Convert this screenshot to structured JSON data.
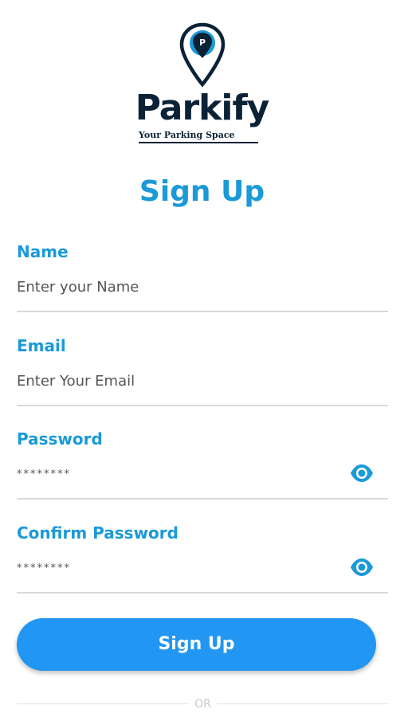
{
  "brand": {
    "name": "Parkify",
    "tagline": "Your Parking Space",
    "color": "#0b2236"
  },
  "title": "Sign Up",
  "accent_color": "#1a9ad8",
  "fields": [
    {
      "label": "Name",
      "placeholder": "Enter your Name",
      "value": "",
      "type": "text"
    },
    {
      "label": "Email",
      "placeholder": "Enter Your Email",
      "value": "",
      "type": "email"
    },
    {
      "label": "Password",
      "placeholder": "********",
      "value": "",
      "type": "password",
      "icon": "eye-icon"
    },
    {
      "label": "Confirm Password",
      "placeholder": "********",
      "value": "",
      "type": "password",
      "icon": "eye-icon"
    }
  ],
  "signup_button": {
    "label": "Sign Up",
    "color": "#2196f3"
  },
  "divider_text": "OR"
}
